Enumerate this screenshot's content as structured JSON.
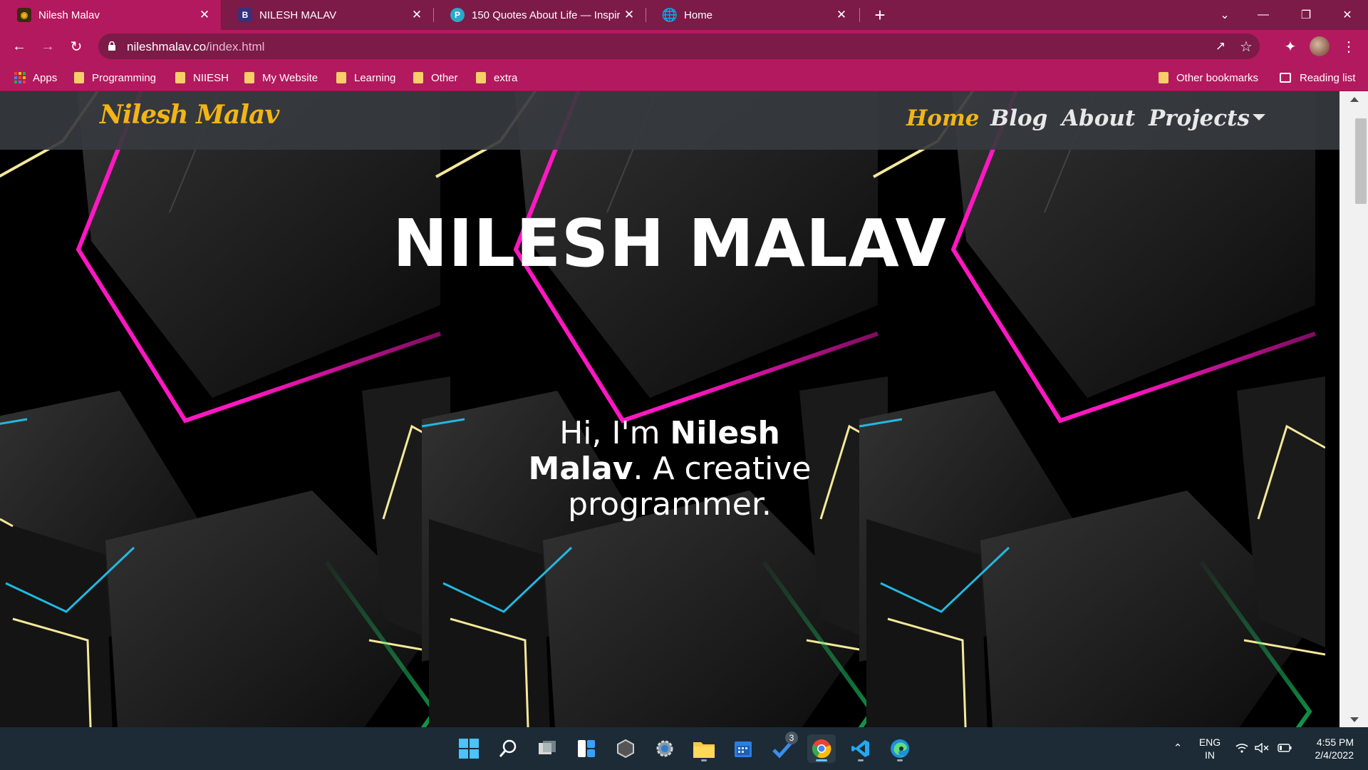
{
  "browser": {
    "tabs": [
      {
        "title": "Nilesh Malav",
        "favicon": "nilesh-favicon",
        "active": true
      },
      {
        "title": "NILESH MALAV",
        "favicon": "B",
        "active": false
      },
      {
        "title": "150 Quotes About Life — Inspirin",
        "favicon": "P",
        "active": false
      },
      {
        "title": "Home",
        "favicon": "globe-icon",
        "active": false
      }
    ],
    "new_tab_label": "+",
    "close_glyph": "✕",
    "url_host": "nileshmalav.co",
    "url_path": "/index.html",
    "bookmarks": [
      {
        "label": "Apps"
      },
      {
        "label": "Programming"
      },
      {
        "label": "NIIESH"
      },
      {
        "label": "My Website"
      },
      {
        "label": "Learning"
      },
      {
        "label": "Other"
      },
      {
        "label": "extra"
      }
    ],
    "other_bookmarks": "Other bookmarks",
    "reading_list": "Reading list",
    "colors": {
      "frame": "#7c1a48",
      "toolbar": "#b3195e"
    }
  },
  "site": {
    "brand": "Nilesh Malav",
    "nav": [
      {
        "label": "Home",
        "active": true
      },
      {
        "label": "Blog",
        "active": false
      },
      {
        "label": "About",
        "active": false
      },
      {
        "label": "Projects",
        "active": false
      }
    ],
    "hero_title": "NILESH MALAV",
    "hero_sub": {
      "prefix": "Hi, I'm ",
      "name": "Nilesh Malav",
      "suffix": ". A creative programmer."
    },
    "colors": {
      "accent": "#f3b417",
      "nav_bg": "#36393e",
      "stroke_pink": "#ff17c1",
      "stroke_green": "#1ed46a",
      "stroke_cyan": "#22b8e0",
      "stroke_yellow": "#f5e89a"
    }
  },
  "taskbar": {
    "apps": [
      "windows-start-icon",
      "search-icon",
      "task-view-icon",
      "widgets-icon",
      "app-icon",
      "settings-icon",
      "file-explorer-icon",
      "calendar-icon",
      "todo-icon",
      "chrome-icon",
      "vscode-icon",
      "edge-icon"
    ],
    "todo_badge": "3",
    "language": [
      "ENG",
      "IN"
    ],
    "time": "4:55 PM",
    "date": "2/4/2022"
  }
}
